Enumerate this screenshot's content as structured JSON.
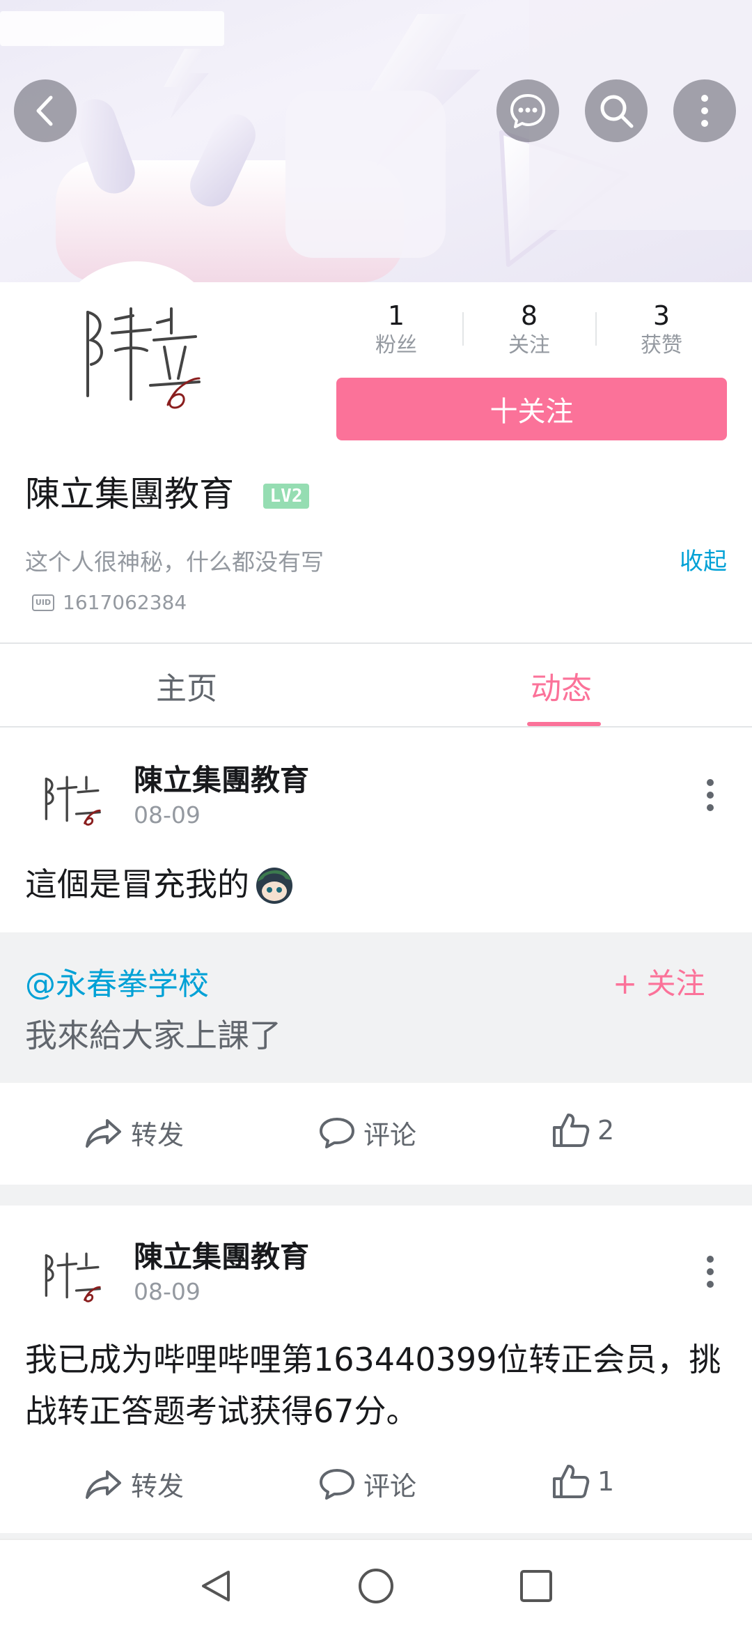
{
  "header": {
    "back_icon": "back-arrow-icon",
    "message_icon": "chat-bubble-icon",
    "search_icon": "search-icon",
    "more_icon": "more-vertical-icon"
  },
  "profile": {
    "stats": [
      {
        "value": "1",
        "label": "粉丝"
      },
      {
        "value": "8",
        "label": "关注"
      },
      {
        "value": "3",
        "label": "获赞"
      }
    ],
    "follow_label": "十关注",
    "name": "陳立集團教育",
    "level": "LV2",
    "bio": "这个人很神秘，什么都没有写",
    "collapse_label": "收起",
    "uid_badge": "UID",
    "uid": "1617062384"
  },
  "tabs": [
    {
      "label": "主页",
      "active": false
    },
    {
      "label": "动态",
      "active": true
    }
  ],
  "posts": [
    {
      "author": "陳立集團教育",
      "date": "08-09",
      "text": "這個是冒充我的",
      "quote": {
        "user": "@永春拳学校",
        "follow_label": "+ 关注",
        "text": "我來給大家上課了"
      },
      "actions": {
        "repost": "转发",
        "comment": "评论",
        "likes": "2"
      }
    },
    {
      "author": "陳立集團教育",
      "date": "08-09",
      "text": "我已成为哔哩哔哩第163440399位转正会员，挑战转正答题考试获得67分。",
      "actions": {
        "repost": "转发",
        "comment": "评论",
        "likes": "1"
      }
    }
  ],
  "colors": {
    "accent": "#fb7299",
    "link": "#00a1d6",
    "level_badge": "#95ddb2"
  }
}
